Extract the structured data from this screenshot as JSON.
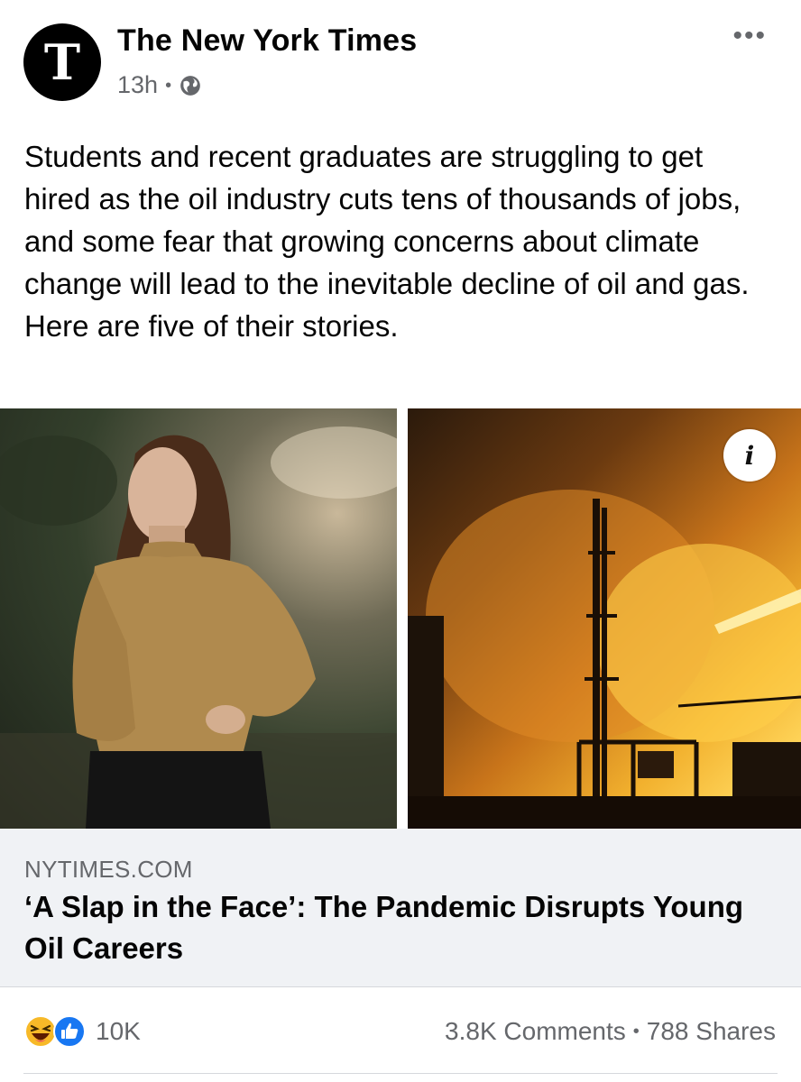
{
  "post": {
    "page_name": "The New York Times",
    "avatar_letter": "T",
    "timestamp": "13h",
    "separator": "•",
    "privacy_icon": "globe-icon",
    "more_label": "•••",
    "text": "Students and recent graduates are struggling to get hired as the oil industry cuts tens of thousands of jobs, and some fear that growing concerns about climate change will lead to the inevitable decline of oil and gas. Here are five of their stories."
  },
  "media": {
    "info_label": "i",
    "photos": [
      "woman-portrait-photo",
      "refinery-smoke-photo"
    ]
  },
  "link": {
    "domain": "NYTIMES.COM",
    "headline": "‘A Slap in the Face’: The Pandemic Disrupts Young Oil Careers"
  },
  "engagement": {
    "reaction_icons": [
      "haha-icon",
      "like-icon"
    ],
    "reaction_count": "10K",
    "comments": "3.8K Comments",
    "separator": "•",
    "shares": "788 Shares"
  },
  "colors": {
    "text": "#050505",
    "secondary": "#65676b",
    "link_card_bg": "#f0f2f5",
    "like_blue": "#1877f2",
    "haha_yellow": "#f7b928"
  }
}
